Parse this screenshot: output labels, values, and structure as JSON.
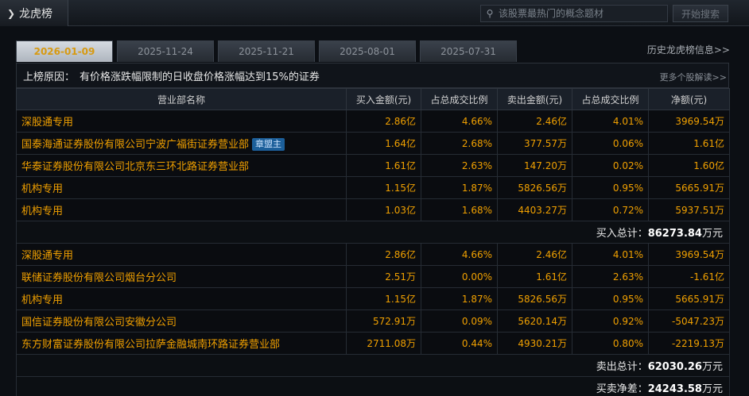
{
  "header": {
    "title": "龙虎榜",
    "search_placeholder": "该股票最热门的概念题材",
    "search_button": "开始搜索"
  },
  "tabs": [
    {
      "label": "2026-01-09",
      "active": true
    },
    {
      "label": "2025-11-24",
      "active": false
    },
    {
      "label": "2025-11-21",
      "active": false
    },
    {
      "label": "2025-08-01",
      "active": false
    },
    {
      "label": "2025-07-31",
      "active": false
    }
  ],
  "history_link": "历史龙虎榜信息>>",
  "reason": {
    "label": "上榜原因：",
    "text": "有价格涨跌幅限制的日收盘价格涨幅达到15%的证券",
    "more": "更多个股解读>>"
  },
  "columns": [
    "营业部名称",
    "买入金额(元)",
    "占总成交比例",
    "卖出金额(元)",
    "占总成交比例",
    "净额(元)"
  ],
  "buy_rows": [
    {
      "name": "深股通专用",
      "badge": "",
      "buy": "2.86亿",
      "buy_pct": "4.66%",
      "sell": "2.46亿",
      "sell_pct": "4.01%",
      "net": "3969.54万"
    },
    {
      "name": "国泰海通证券股份有限公司宁波广福街证券营业部",
      "badge": "章盟主",
      "buy": "1.64亿",
      "buy_pct": "2.68%",
      "sell": "377.57万",
      "sell_pct": "0.06%",
      "net": "1.61亿"
    },
    {
      "name": "华泰证券股份有限公司北京东三环北路证券营业部",
      "badge": "",
      "buy": "1.61亿",
      "buy_pct": "2.63%",
      "sell": "147.20万",
      "sell_pct": "0.02%",
      "net": "1.60亿"
    },
    {
      "name": "机构专用",
      "badge": "",
      "buy": "1.15亿",
      "buy_pct": "1.87%",
      "sell": "5826.56万",
      "sell_pct": "0.95%",
      "net": "5665.91万"
    },
    {
      "name": "机构专用",
      "badge": "",
      "buy": "1.03亿",
      "buy_pct": "1.68%",
      "sell": "4403.27万",
      "sell_pct": "0.72%",
      "net": "5937.51万"
    }
  ],
  "buy_total": {
    "label": "买入总计：",
    "value": "86273.84",
    "unit": "万元"
  },
  "sell_rows": [
    {
      "name": "深股通专用",
      "badge": "",
      "buy": "2.86亿",
      "buy_pct": "4.66%",
      "sell": "2.46亿",
      "sell_pct": "4.01%",
      "net": "3969.54万"
    },
    {
      "name": "联储证券股份有限公司烟台分公司",
      "badge": "",
      "buy": "2.51万",
      "buy_pct": "0.00%",
      "sell": "1.61亿",
      "sell_pct": "2.63%",
      "net": "-1.61亿"
    },
    {
      "name": "机构专用",
      "badge": "",
      "buy": "1.15亿",
      "buy_pct": "1.87%",
      "sell": "5826.56万",
      "sell_pct": "0.95%",
      "net": "5665.91万"
    },
    {
      "name": "国信证券股份有限公司安徽分公司",
      "badge": "",
      "buy": "572.91万",
      "buy_pct": "0.09%",
      "sell": "5620.14万",
      "sell_pct": "0.92%",
      "net": "-5047.23万"
    },
    {
      "name": "东方财富证券股份有限公司拉萨金融城南环路证券营业部",
      "badge": "",
      "buy": "2711.08万",
      "buy_pct": "0.44%",
      "sell": "4930.21万",
      "sell_pct": "0.80%",
      "net": "-2219.13万"
    }
  ],
  "sell_total": {
    "label": "卖出总计：",
    "value": "62030.26",
    "unit": "万元"
  },
  "net_total": {
    "label": "买卖净差：",
    "value": "24243.58",
    "unit": "万元"
  }
}
